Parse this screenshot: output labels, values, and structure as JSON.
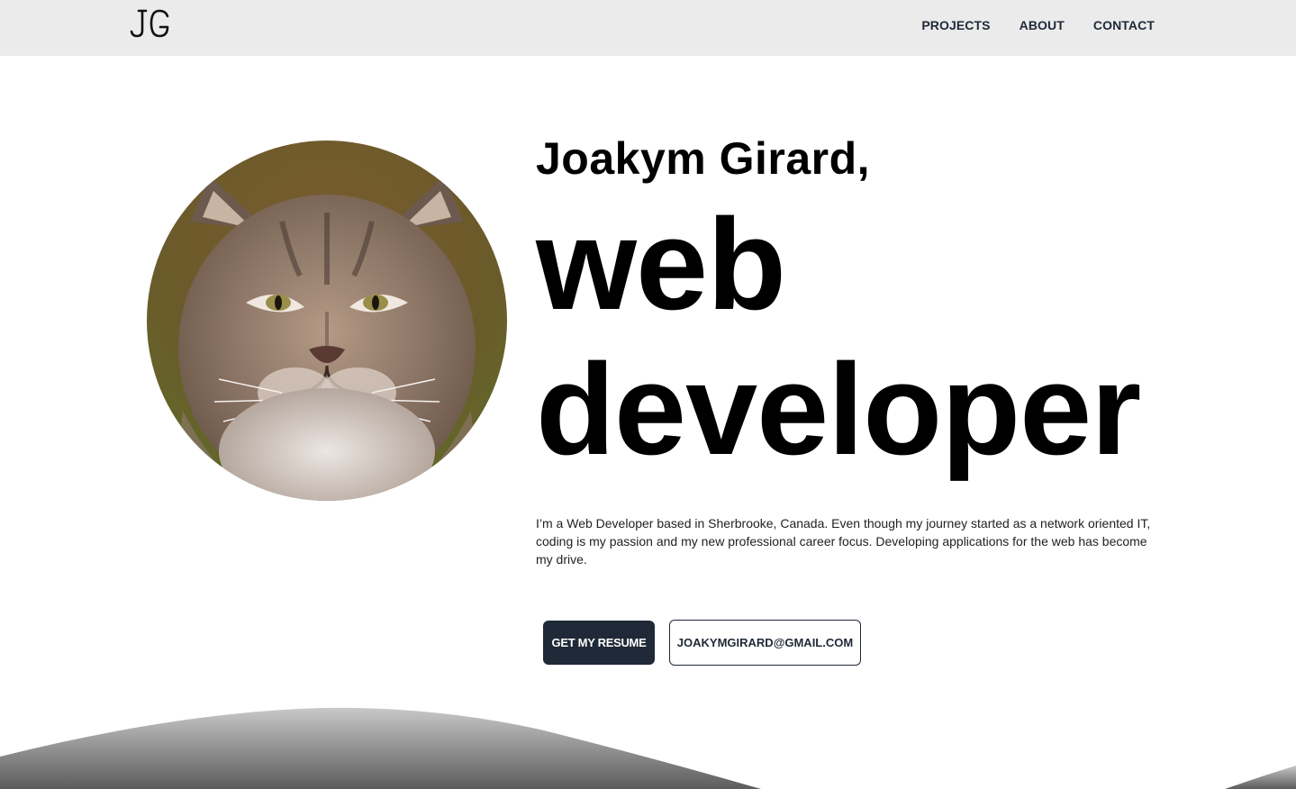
{
  "nav": {
    "logo_text": "JG",
    "links": [
      {
        "label": "PROJECTS"
      },
      {
        "label": "ABOUT"
      },
      {
        "label": "CONTACT"
      }
    ]
  },
  "hero": {
    "name": "Joakym Girard,",
    "role_line1": "web",
    "role_line2": "developer",
    "bio": "I’m a Web Developer based in Sherbrooke, Canada. Even though my journey started as a network oriented IT, coding is my passion and my new professional career focus. Developing applications for the web has become my drive.",
    "resume_button": "GET MY RESUME",
    "email_button": "JOAKYMGIRARD@GMAIL.COM",
    "avatar": "lynx-portrait"
  },
  "colors": {
    "navbar_bg": "#ebebeb",
    "button_dark": "#1f2937",
    "wave_gray": "#8a8a8a"
  }
}
